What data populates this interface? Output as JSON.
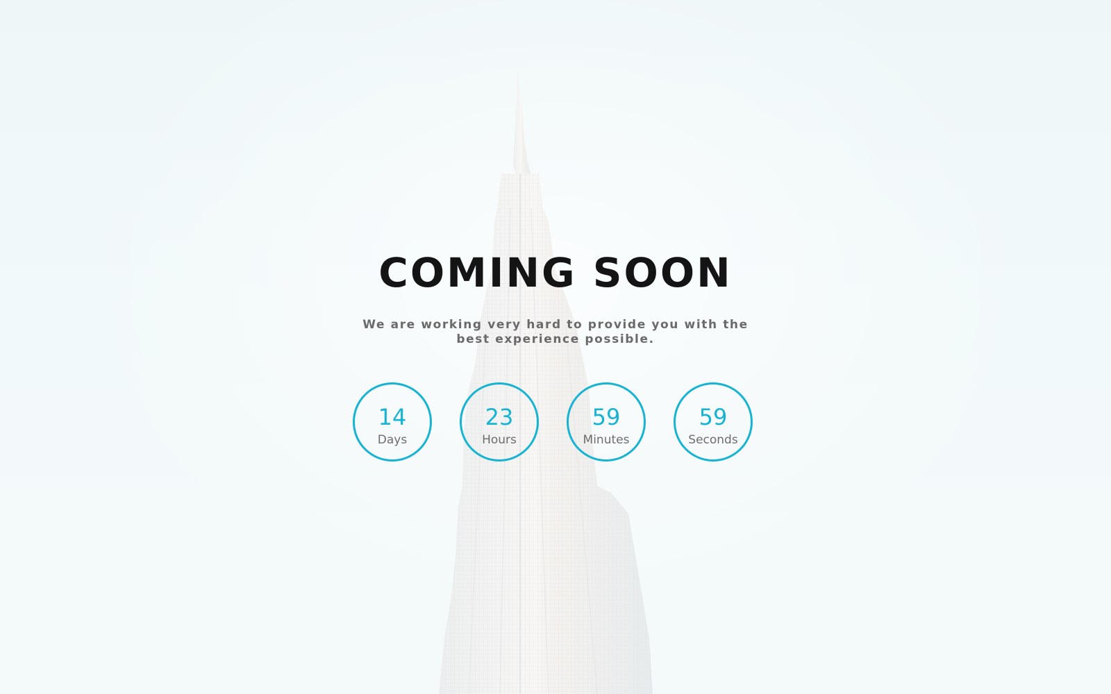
{
  "page": {
    "title": "COMING SOON",
    "subtitle": "We are working very hard to provide you with the best experience possible."
  },
  "countdown": [
    {
      "value": "14",
      "label": "Days"
    },
    {
      "value": "23",
      "label": "Hours"
    },
    {
      "value": "59",
      "label": "Minutes"
    },
    {
      "value": "59",
      "label": "Seconds"
    }
  ],
  "colors": {
    "accent": "#17b3d3",
    "title": "#141414",
    "text": "#6a6a6a",
    "sky": "#eaf4f6"
  },
  "background": {
    "subject": "skyscraper-tower-image"
  }
}
